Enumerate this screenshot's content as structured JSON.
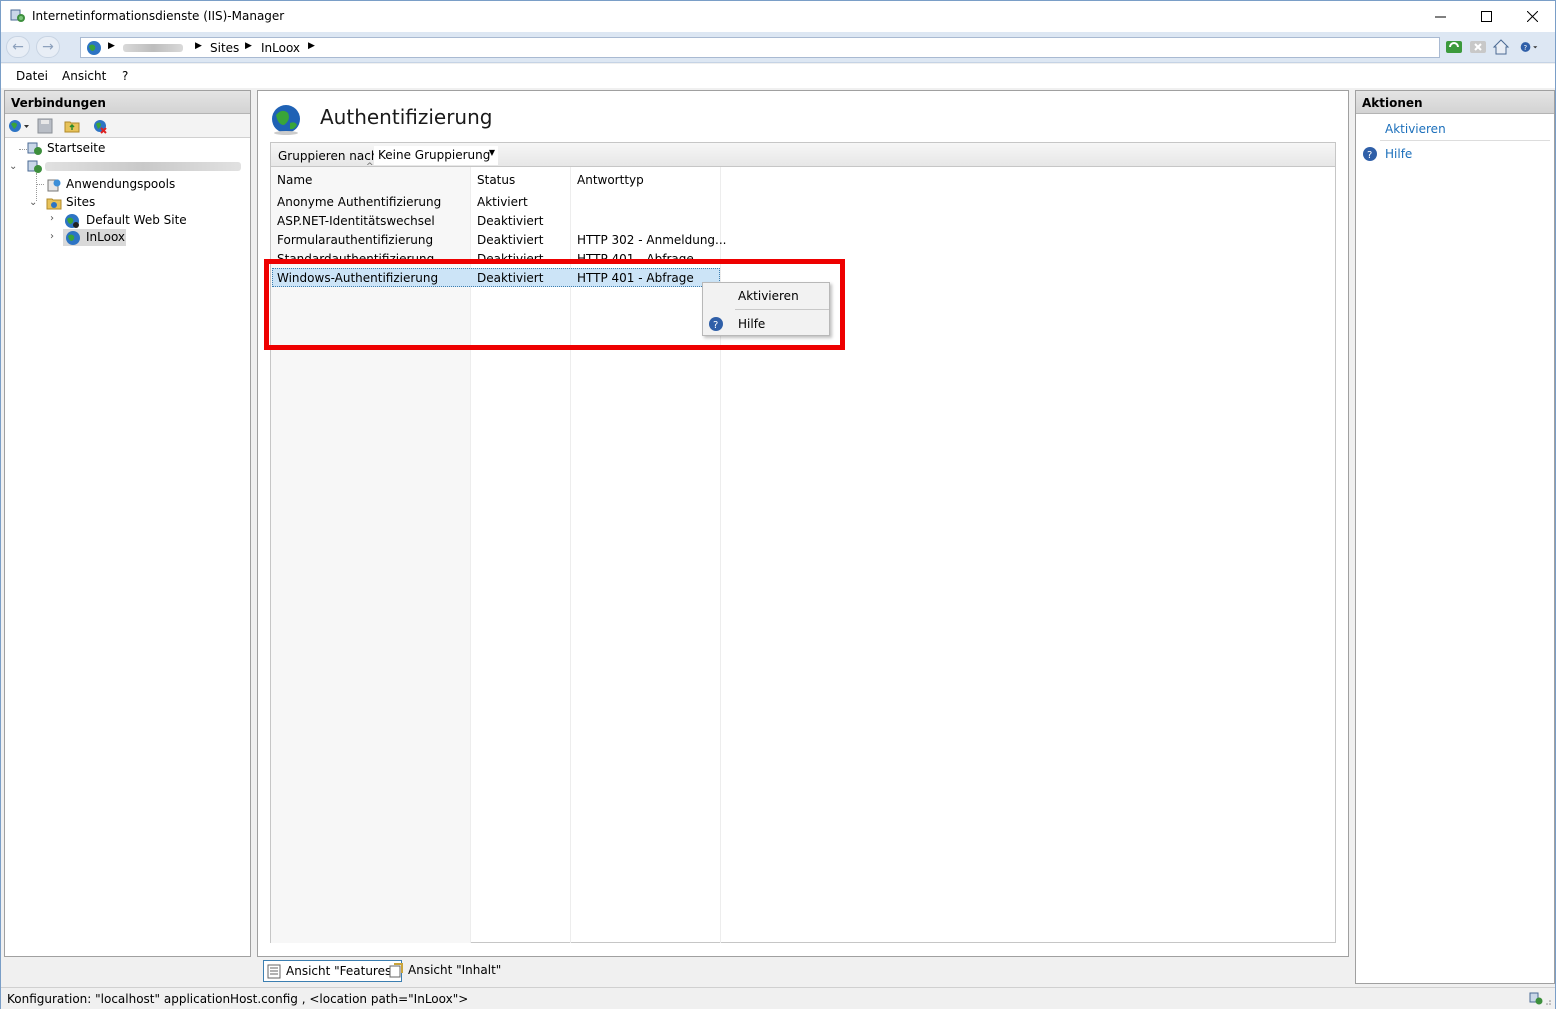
{
  "window": {
    "title": "Internetinformationsdienste (IIS)-Manager",
    "minimize": "—",
    "maximize": "☐",
    "close": "✕"
  },
  "address": {
    "crumbs": [
      "Sites",
      "InLoox"
    ]
  },
  "menu": {
    "items": [
      "Datei",
      "Ansicht",
      "?"
    ]
  },
  "connections": {
    "header": "Verbindungen",
    "tree": {
      "start": "Startseite",
      "app_pools": "Anwendungspools",
      "sites": "Sites",
      "default_site": "Default Web Site",
      "inloox": "InLoox"
    }
  },
  "main": {
    "title": "Authentifizierung",
    "group_label": "Gruppieren nach:",
    "group_value": "Keine Gruppierung",
    "columns": [
      "Name",
      "Status",
      "Antworttyp"
    ],
    "rows": [
      {
        "name": "Anonyme Authentifizierung",
        "status": "Aktiviert",
        "type": ""
      },
      {
        "name": "ASP.NET-Identitätswechsel",
        "status": "Deaktiviert",
        "type": ""
      },
      {
        "name": "Formularauthentifizierung",
        "status": "Deaktiviert",
        "type": "HTTP 302 - Anmeldung..."
      },
      {
        "name": "Standardauthentifizierung",
        "status": "Deaktiviert",
        "type": "HTTP 401 - Abfrage"
      },
      {
        "name": "Windows-Authentifizierung",
        "status": "Deaktiviert",
        "type": "HTTP 401 - Abfrage"
      }
    ],
    "context_menu": {
      "activate": "Aktivieren",
      "help": "Hilfe"
    },
    "view_tabs": {
      "features": "Ansicht \"Features\"",
      "content": "Ansicht \"Inhalt\""
    }
  },
  "actions": {
    "header": "Aktionen",
    "activate": "Aktivieren",
    "help": "Hilfe"
  },
  "status": {
    "text": "Konfiguration: \"localhost\" applicationHost.config , <location path=\"InLoox\">"
  },
  "colors": {
    "highlight": "#ee0000",
    "link": "#1b6fbb",
    "selection": "#cce4f7"
  }
}
